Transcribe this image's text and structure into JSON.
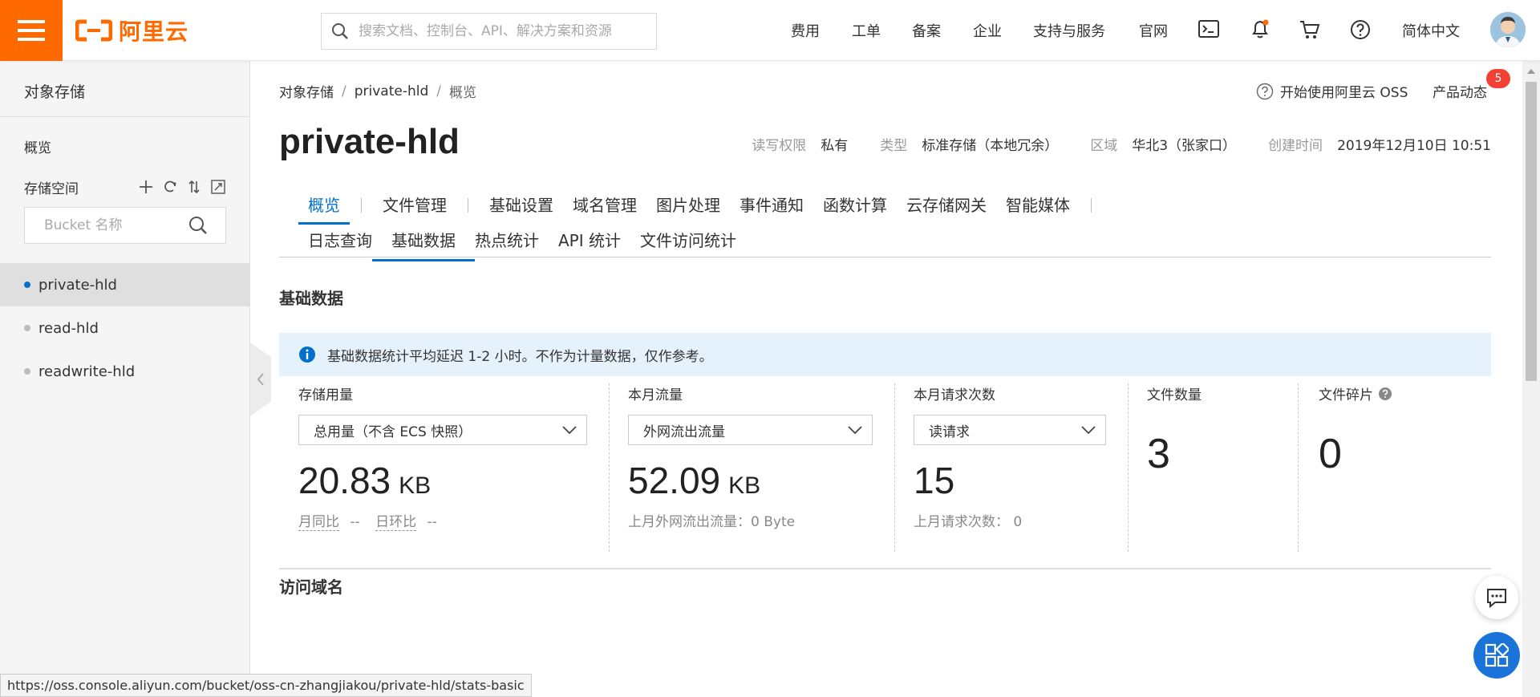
{
  "topbar": {
    "logo_text": "阿里云",
    "search_placeholder": "搜索文档、控制台、API、解决方案和资源",
    "nav": [
      "费用",
      "工单",
      "备案",
      "企业",
      "支持与服务",
      "官网"
    ],
    "language": "简体中文"
  },
  "sidebar": {
    "title": "对象存储",
    "overview": "概览",
    "storage_label": "存储空间",
    "bucket_placeholder": "Bucket 名称",
    "buckets": [
      "private-hld",
      "read-hld",
      "readwrite-hld"
    ]
  },
  "breadcrumb": [
    "对象存储",
    "private-hld",
    "概览"
  ],
  "header": {
    "help_link": "开始使用阿里云 OSS",
    "news_link": "产品动态",
    "news_badge": "5",
    "title": "private-hld",
    "meta": {
      "acl_label": "读写权限",
      "acl_value": "私有",
      "type_label": "类型",
      "type_value": "标准存储（本地冗余）",
      "region_label": "区域",
      "region_value": "华北3（张家口）",
      "created_label": "创建时间",
      "created_value": "2019年12月10日 10:51"
    }
  },
  "tabs": {
    "row1": [
      "概览",
      "文件管理",
      "基础设置",
      "域名管理",
      "图片处理",
      "事件通知",
      "函数计算",
      "云存储网关",
      "智能媒体"
    ],
    "row2": [
      "日志查询",
      "基础数据",
      "热点统计",
      "API 统计",
      "文件访问统计"
    ],
    "active_row1": "概览",
    "active_row2": "基础数据"
  },
  "section": {
    "title": "基础数据",
    "alert": "基础数据统计平均延迟 1-2 小时。不作为计量数据，仅作参考。"
  },
  "metrics": {
    "storage": {
      "label": "存储用量",
      "select": "总用量（不含 ECS 快照）",
      "value": "20.83",
      "unit": "KB",
      "sub1": "月同比",
      "sub1_val": "--",
      "sub2": "日环比",
      "sub2_val": "--"
    },
    "traffic": {
      "label": "本月流量",
      "select": "外网流出流量",
      "value": "52.09",
      "unit": "KB",
      "sub": "上月外网流出流量：0 Byte"
    },
    "requests": {
      "label": "本月请求次数",
      "select": "读请求",
      "value": "15",
      "sub": "上月请求次数：  0"
    },
    "files": {
      "label": "文件数量",
      "value": "3"
    },
    "fragments": {
      "label": "文件碎片",
      "value": "0"
    }
  },
  "section2": {
    "title": "访问域名"
  },
  "status_url": "https://oss.console.aliyun.com/bucket/oss-cn-zhangjiakou/private-hld/stats-basic"
}
